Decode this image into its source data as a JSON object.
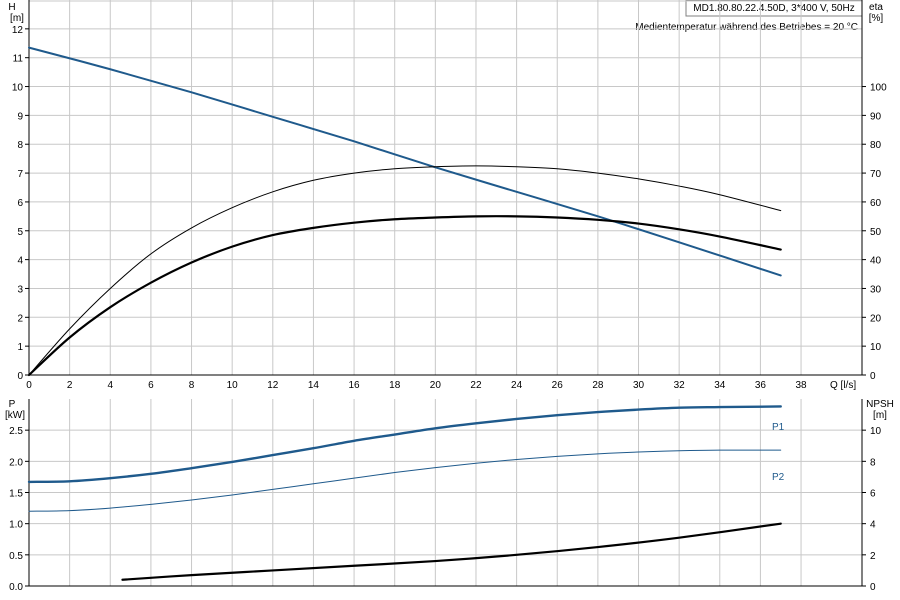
{
  "header": {
    "model": "MD1.80.80.22.4.50D, 3*400 V, 50Hz",
    "note": "Medientemperatur während des Betriebes = 20 °C"
  },
  "colors": {
    "grid": "#c8c8c8",
    "axis": "#000000",
    "pump_blue": "#1f5a8c",
    "black": "#000000"
  },
  "chart_data": [
    {
      "type": "line",
      "panel": "performance",
      "x_axis": {
        "label": "Q [l/s]",
        "range": [
          0,
          41
        ],
        "ticks": [
          0,
          2,
          4,
          6,
          8,
          10,
          12,
          14,
          16,
          18,
          20,
          22,
          24,
          26,
          28,
          30,
          32,
          34,
          36,
          38
        ]
      },
      "y_left": {
        "label_line1": "H",
        "label_line2": "[m]",
        "range": [
          0,
          13
        ],
        "ticks": [
          0,
          1,
          2,
          3,
          4,
          5,
          6,
          7,
          8,
          9,
          10,
          11,
          12
        ]
      },
      "y_right": {
        "label_line1": "eta",
        "label_line2": "[%]",
        "range": [
          0,
          130
        ],
        "ticks": [
          0,
          10,
          20,
          30,
          40,
          50,
          60,
          70,
          80,
          90,
          100
        ]
      },
      "grid": true,
      "series": [
        {
          "role": "head",
          "axis": "left",
          "color": "#1f5a8c",
          "width": 2,
          "x": [
            0,
            4,
            8,
            12,
            16,
            20,
            24,
            28,
            32,
            37
          ],
          "y": [
            11.35,
            10.6,
            9.8,
            8.95,
            8.1,
            7.2,
            6.35,
            5.5,
            4.6,
            3.45
          ]
        },
        {
          "role": "efficiency_upper",
          "axis": "left",
          "color": "#000000",
          "width": 1,
          "x": [
            0,
            2,
            4,
            6,
            8,
            10,
            12,
            14,
            16,
            18,
            20,
            22,
            24,
            26,
            28,
            30,
            32,
            34,
            37
          ],
          "y": [
            0,
            1.6,
            3.0,
            4.2,
            5.1,
            5.8,
            6.35,
            6.75,
            7.0,
            7.15,
            7.22,
            7.25,
            7.22,
            7.15,
            7.0,
            6.8,
            6.55,
            6.25,
            5.7
          ]
        },
        {
          "role": "efficiency_lower",
          "axis": "left",
          "color": "#000000",
          "width": 2.2,
          "x": [
            0,
            2,
            4,
            6,
            8,
            10,
            12,
            14,
            16,
            18,
            20,
            22,
            24,
            26,
            28,
            30,
            32,
            34,
            37
          ],
          "y": [
            0,
            1.3,
            2.35,
            3.2,
            3.9,
            4.45,
            4.85,
            5.1,
            5.28,
            5.4,
            5.46,
            5.5,
            5.5,
            5.46,
            5.38,
            5.25,
            5.05,
            4.8,
            4.35
          ]
        }
      ]
    },
    {
      "type": "line",
      "panel": "power_npsh",
      "x_axis": {
        "range": [
          0,
          41
        ],
        "ticks": [
          0,
          2,
          4,
          6,
          8,
          10,
          12,
          14,
          16,
          18,
          20,
          22,
          24,
          26,
          28,
          30,
          32,
          34,
          36,
          38
        ]
      },
      "y_left": {
        "label_line1": "P",
        "label_line2": "[kW]",
        "range": [
          0,
          3.0
        ],
        "ticks": [
          0,
          0.5,
          1.0,
          1.5,
          2.0,
          2.5
        ],
        "tick_labels": [
          "0.0",
          "0.5",
          "1.0",
          "1.5",
          "2.0",
          "2.5"
        ]
      },
      "y_right": {
        "label_line1": "NPSH",
        "label_line2": "[m]",
        "range": [
          0,
          12
        ],
        "ticks": [
          0,
          2,
          4,
          6,
          8,
          10
        ],
        "tick_labels": [
          "0",
          "2",
          "4",
          "6",
          "8",
          "10"
        ]
      },
      "grid": true,
      "series": [
        {
          "name": "P1",
          "axis": "left",
          "color": "#1f5a8c",
          "width": 2.4,
          "x": [
            0,
            2,
            4,
            6,
            8,
            10,
            12,
            14,
            16,
            18,
            20,
            22,
            24,
            26,
            28,
            30,
            32,
            34,
            37
          ],
          "y": [
            1.67,
            1.68,
            1.73,
            1.8,
            1.89,
            1.99,
            2.1,
            2.21,
            2.33,
            2.43,
            2.53,
            2.61,
            2.68,
            2.74,
            2.79,
            2.83,
            2.86,
            2.87,
            2.88
          ]
        },
        {
          "name": "P2",
          "axis": "left",
          "color": "#1f5a8c",
          "width": 1,
          "x": [
            0,
            2,
            4,
            6,
            8,
            10,
            12,
            14,
            16,
            18,
            20,
            22,
            24,
            26,
            28,
            30,
            32,
            34,
            37
          ],
          "y": [
            1.2,
            1.21,
            1.25,
            1.31,
            1.38,
            1.46,
            1.55,
            1.64,
            1.73,
            1.82,
            1.9,
            1.97,
            2.03,
            2.08,
            2.12,
            2.15,
            2.17,
            2.18,
            2.18
          ]
        },
        {
          "role": "npsh",
          "axis": "right",
          "color": "#000000",
          "width": 2.2,
          "x": [
            4.6,
            8,
            12,
            16,
            20,
            24,
            28,
            32,
            37
          ],
          "y": [
            0.4,
            0.7,
            1.0,
            1.3,
            1.6,
            2.0,
            2.5,
            3.1,
            4.0
          ]
        }
      ]
    }
  ]
}
